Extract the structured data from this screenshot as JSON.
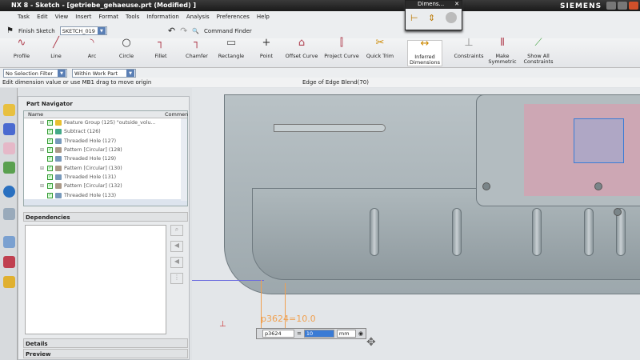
{
  "window": {
    "title": "NX 8 - Sketch - [getriebe_gehaeuse.prt (Modified) ]",
    "brand": "SIEMENS"
  },
  "menu": [
    "Task",
    "Edit",
    "View",
    "Insert",
    "Format",
    "Tools",
    "Information",
    "Analysis",
    "Preferences",
    "Help"
  ],
  "toolbar": {
    "finish_sketch": "Finish Sketch",
    "sketch_name": "SKETCH_019",
    "command_finder": "Command Finder"
  },
  "ribbon": [
    {
      "label": "Profile",
      "icon": "profile-icon"
    },
    {
      "label": "Line",
      "icon": "line-icon"
    },
    {
      "label": "Arc",
      "icon": "arc-icon"
    },
    {
      "label": "Circle",
      "icon": "circle-icon"
    },
    {
      "label": "Fillet",
      "icon": "fillet-icon"
    },
    {
      "label": "Chamfer",
      "icon": "chamfer-icon"
    },
    {
      "label": "Rectangle",
      "icon": "rectangle-icon"
    },
    {
      "label": "Point",
      "icon": "point-icon"
    },
    {
      "label": "Offset Curve",
      "icon": "offset-curve-icon"
    },
    {
      "label": "Project Curve",
      "icon": "project-curve-icon"
    },
    {
      "label": "Quick Trim",
      "icon": "quick-trim-icon"
    },
    {
      "label": "Inferred Dimensions",
      "icon": "inferred-dimensions-icon",
      "active": true
    },
    {
      "label": "Constraints",
      "icon": "constraints-icon"
    },
    {
      "label": "Make Symmetric",
      "icon": "make-symmetric-icon"
    },
    {
      "label": "Show All Constraints",
      "icon": "show-constraints-icon"
    }
  ],
  "filters": {
    "selection": "No Selection Filter",
    "scope": "Within Work Part Only"
  },
  "status": {
    "prompt": "Edit dimension value or use MB1 drag to move origin",
    "selection": "Edge of Edge Blend(70)"
  },
  "dim_popup": {
    "title": "Dimens..."
  },
  "navigator": {
    "title": "Part Navigator",
    "col_name": "Name",
    "col_comment": "Commen",
    "rows": [
      {
        "label": "Feature Group (125) \"outside_volu...",
        "expandable": true
      },
      {
        "label": "Subtract (126)",
        "expandable": false
      },
      {
        "label": "Threaded Hole (127)",
        "expandable": false
      },
      {
        "label": "Pattern [Circular] (128)",
        "expandable": true
      },
      {
        "label": "Threaded Hole (129)",
        "expandable": false
      },
      {
        "label": "Pattern [Circular] (130)",
        "expandable": true
      },
      {
        "label": "Threaded Hole (131)",
        "expandable": false
      },
      {
        "label": "Pattern [Circular] (132)",
        "expandable": true
      },
      {
        "label": "Threaded Hole (133)",
        "expandable": false
      }
    ],
    "dependencies": "Dependencies",
    "details": "Details",
    "preview": "Preview"
  },
  "dimension": {
    "label": "p3624=10.0",
    "name": "p3624",
    "equals": "=",
    "value": "10",
    "unit": "mm"
  },
  "colors": {
    "accent": "#f0a050",
    "selection": "#3a7bd5"
  }
}
